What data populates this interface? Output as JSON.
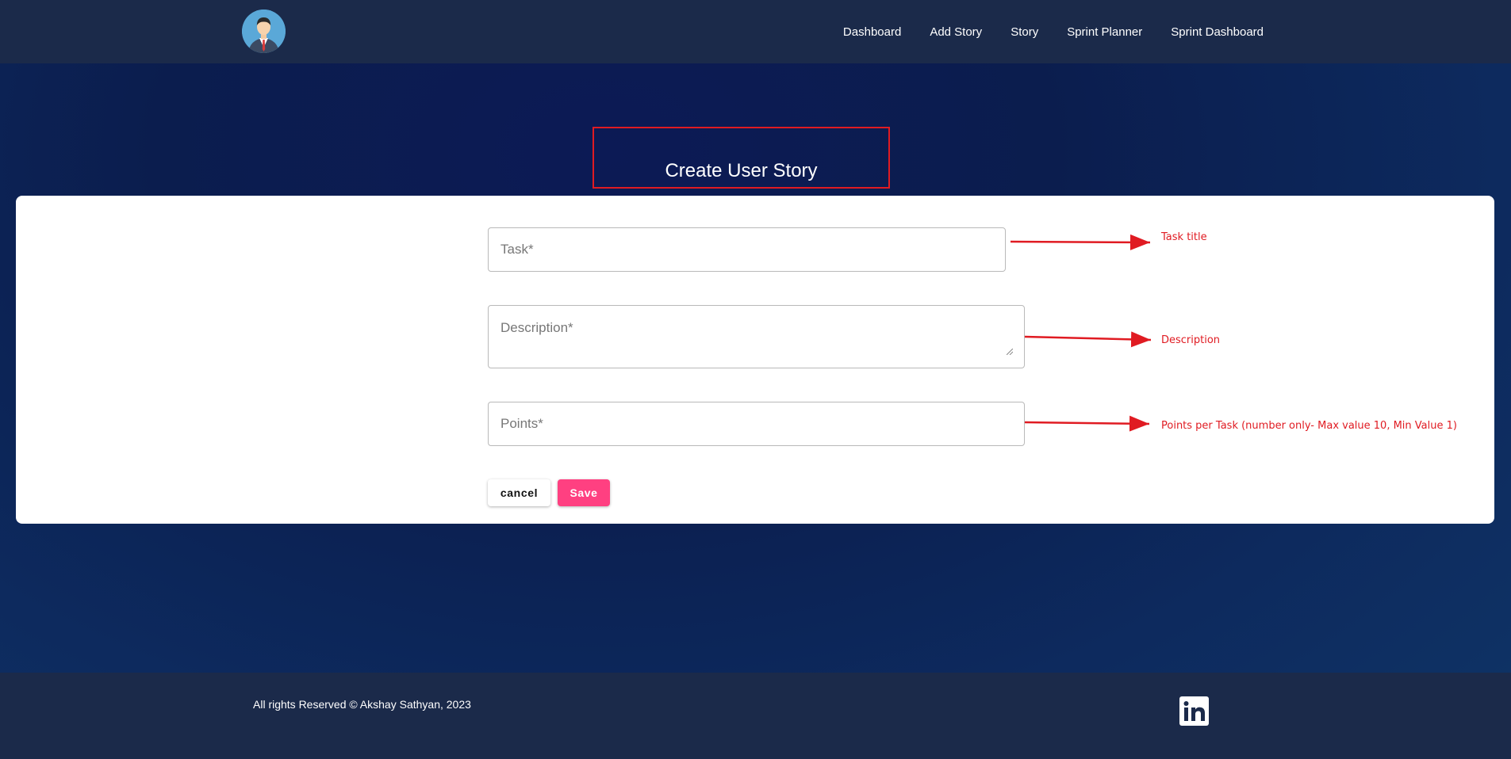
{
  "nav": {
    "links": [
      "Dashboard",
      "Add Story",
      "Story",
      "Sprint Planner",
      "Sprint Dashboard"
    ]
  },
  "page": {
    "title": "Create User Story"
  },
  "form": {
    "task_placeholder": "Task*",
    "task_value": "",
    "description_placeholder": "Description*",
    "description_value": "",
    "points_placeholder": "Points*",
    "points_value": "",
    "cancel_label": "cancel",
    "save_label": "Save"
  },
  "annotations": {
    "task": "Task title",
    "description": "Description",
    "points": "Points per Task (number only- Max value 10, Min Value 1)"
  },
  "footer": {
    "copyright": "All rights Reserved © Akshay Sathyan, 2023"
  },
  "colors": {
    "accent": "#ff4081",
    "navbar": "#1b2a4a",
    "annotation": "#e01b22"
  },
  "icons": {
    "avatar": "user-avatar-icon",
    "linkedin": "linkedin-icon"
  }
}
